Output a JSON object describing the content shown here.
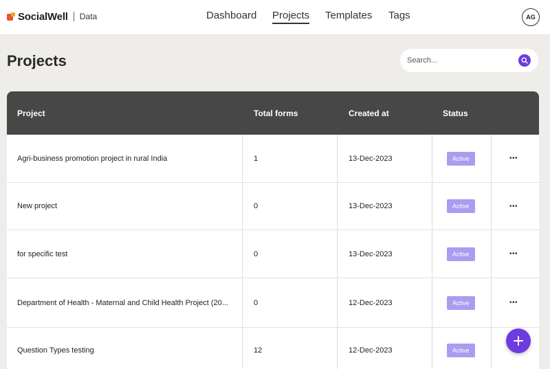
{
  "brand": {
    "name": "SocialWell",
    "sub": "Data"
  },
  "nav": {
    "items": [
      {
        "label": "Dashboard",
        "active": false
      },
      {
        "label": "Projects",
        "active": true
      },
      {
        "label": "Templates",
        "active": false
      },
      {
        "label": "Tags",
        "active": false
      }
    ]
  },
  "user": {
    "initials": "AG"
  },
  "page": {
    "title": "Projects"
  },
  "search": {
    "placeholder": "Search..."
  },
  "table": {
    "headers": [
      "Project",
      "Total forms",
      "Created at",
      "Status"
    ],
    "rows": [
      {
        "name": "Agri-business promotion project in rural India",
        "forms": "1",
        "created": "13-Dec-2023",
        "status": "Active"
      },
      {
        "name": "New project",
        "forms": "0",
        "created": "13-Dec-2023",
        "status": "Active"
      },
      {
        "name": "for specific test",
        "forms": "0",
        "created": "13-Dec-2023",
        "status": "Active"
      },
      {
        "name": "Department of Health - Maternal and Child Health Project (20...",
        "forms": "0",
        "created": "12-Dec-2023",
        "status": "Active"
      },
      {
        "name": "Question Types testing",
        "forms": "12",
        "created": "12-Dec-2023",
        "status": "Active"
      }
    ]
  },
  "colors": {
    "accent": "#6d3ce0",
    "badge": "#a99df0",
    "header_bg": "#474747"
  },
  "icons": {
    "search": "search-icon",
    "add": "plus-icon",
    "more": "more-icon"
  }
}
